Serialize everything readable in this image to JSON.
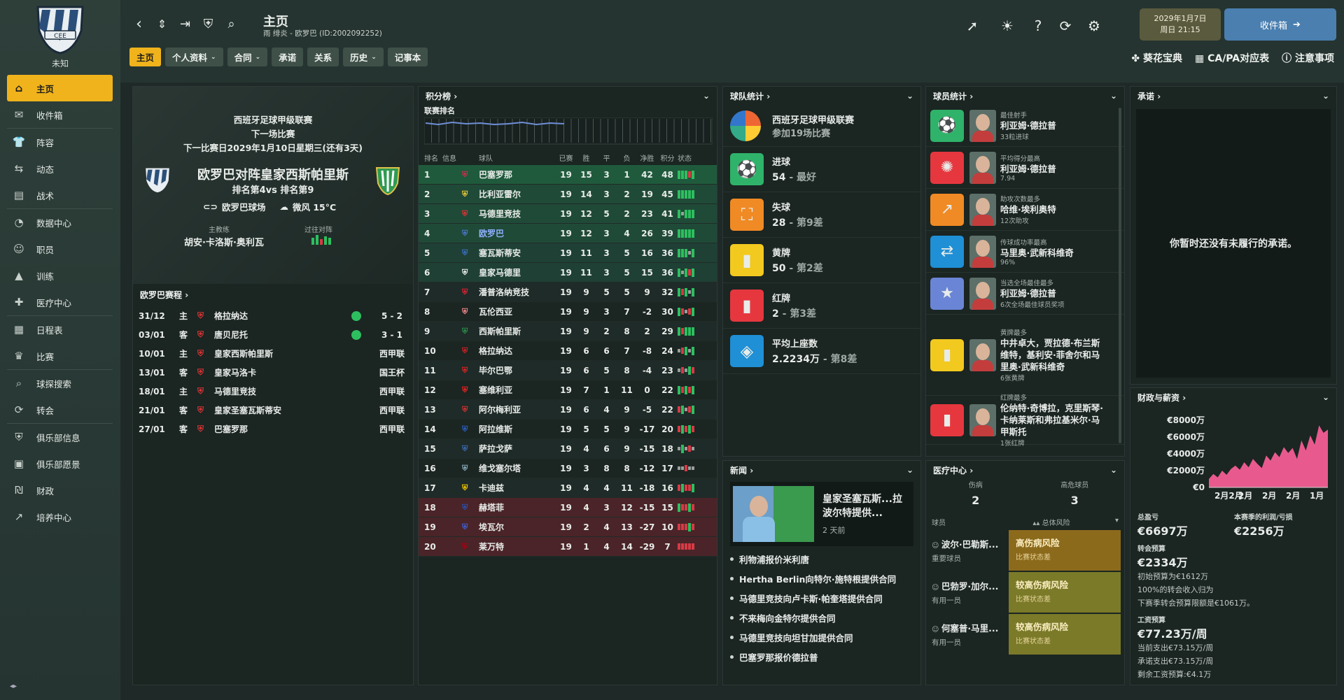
{
  "sidebar": {
    "club_name": "未知",
    "items": [
      {
        "label": "主页",
        "icon": "home-icon"
      },
      {
        "label": "收件箱",
        "icon": "inbox-icon"
      },
      {
        "label": "阵容",
        "icon": "shirt-icon"
      },
      {
        "label": "动态",
        "icon": "dynamics-icon"
      },
      {
        "label": "战术",
        "icon": "tactics-icon"
      },
      {
        "label": "数据中心",
        "icon": "data-icon"
      },
      {
        "label": "职员",
        "icon": "staff-icon"
      },
      {
        "label": "训练",
        "icon": "training-icon"
      },
      {
        "label": "医疗中心",
        "icon": "medical-icon"
      },
      {
        "label": "日程表",
        "icon": "calendar-icon"
      },
      {
        "label": "比赛",
        "icon": "trophy-icon"
      },
      {
        "label": "球探搜索",
        "icon": "search-icon"
      },
      {
        "label": "转会",
        "icon": "transfer-icon"
      },
      {
        "label": "俱乐部信息",
        "icon": "shield-icon"
      },
      {
        "label": "俱乐部愿景",
        "icon": "briefcase-icon"
      },
      {
        "label": "财政",
        "icon": "money-icon"
      },
      {
        "label": "培养中心",
        "icon": "chart-icon"
      }
    ]
  },
  "header": {
    "title": "主页",
    "subtitle": "雨 绯炎 - 欧罗巴 (ID:2002092252)",
    "tabs": [
      "主页",
      "个人资料",
      "合同",
      "承诺",
      "关系",
      "历史",
      "记事本"
    ],
    "date_line1": "2029年1月7日",
    "date_line2": "周日 21:15",
    "inbox_label": "收件箱",
    "links": [
      "葵花宝典",
      "CA/PA对应表",
      "注意事项"
    ]
  },
  "next_match": {
    "competition": "西班牙足球甲级联赛",
    "label": "下一场比赛",
    "date_line": "下一比赛日2029年1月10日星期三(还有3天)",
    "title": "欧罗巴对阵皇家西斯帕里斯",
    "rank_line": "排名第4vs 排名第9",
    "stadium": "欧罗巴球场",
    "weather": "微风 15°C",
    "coach_label": "主教练",
    "coach": "胡安·卡洛斯·奥利瓦",
    "past_label": "过往对阵"
  },
  "fixtures": {
    "title": "欧罗巴赛程",
    "rows": [
      {
        "date": "31/12",
        "venue": "主",
        "team": "格拉纳达",
        "res": "5 - 2",
        "win": true
      },
      {
        "date": "03/01",
        "venue": "客",
        "team": "唐贝尼托",
        "res": "3 - 1",
        "win": true
      },
      {
        "date": "10/01",
        "venue": "主",
        "team": "皇家西斯帕里斯",
        "res": "西甲联",
        "win": false
      },
      {
        "date": "13/01",
        "venue": "客",
        "team": "皇家马洛卡",
        "res": "国王杯",
        "win": false
      },
      {
        "date": "18/01",
        "venue": "主",
        "team": "马德里竞技",
        "res": "西甲联",
        "win": false
      },
      {
        "date": "21/01",
        "venue": "客",
        "team": "皇家圣塞瓦斯蒂安",
        "res": "西甲联",
        "win": false
      },
      {
        "date": "27/01",
        "venue": "客",
        "team": "巴塞罗那",
        "res": "西甲联",
        "win": false
      }
    ]
  },
  "standings": {
    "title": "积分榜",
    "chart_label": "联赛排名",
    "headers": [
      "排名",
      "信息",
      "球队",
      "已赛",
      "胜",
      "平",
      "负",
      "净胜",
      "积分",
      "状态"
    ],
    "rows": [
      {
        "pos": "1",
        "team": "巴塞罗那",
        "p": "19",
        "w": "15",
        "d": "3",
        "l": "1",
        "gd": "42",
        "pts": "48",
        "form": "gggrg",
        "bg": "#1f5a3c"
      },
      {
        "pos": "2",
        "team": "比利亚雷尔",
        "p": "19",
        "w": "14",
        "d": "3",
        "l": "2",
        "gd": "19",
        "pts": "45",
        "form": "ggggg",
        "bg": "#204a38"
      },
      {
        "pos": "3",
        "team": "马德里竞技",
        "p": "19",
        "w": "12",
        "d": "5",
        "l": "2",
        "gd": "23",
        "pts": "41",
        "form": "gyggg",
        "bg": "#204a38"
      },
      {
        "pos": "4",
        "team": "欧罗巴",
        "p": "19",
        "w": "12",
        "d": "3",
        "l": "4",
        "gd": "26",
        "pts": "39",
        "form": "ggggg",
        "bg": "#204a38",
        "highlight": true
      },
      {
        "pos": "5",
        "team": "塞瓦斯蒂安",
        "p": "19",
        "w": "11",
        "d": "3",
        "l": "5",
        "gd": "16",
        "pts": "36",
        "form": "gggyg",
        "bg": "#1f4035"
      },
      {
        "pos": "6",
        "team": "皇家马德里",
        "p": "19",
        "w": "11",
        "d": "3",
        "l": "5",
        "gd": "15",
        "pts": "36",
        "form": "gygrg",
        "bg": "#1f4035"
      },
      {
        "pos": "7",
        "team": "潘普洛纳竞技",
        "p": "19",
        "w": "9",
        "d": "5",
        "l": "5",
        "gd": "9",
        "pts": "32",
        "form": "grgyg",
        "bg": "#1f2b28"
      },
      {
        "pos": "8",
        "team": "瓦伦西亚",
        "p": "19",
        "w": "9",
        "d": "3",
        "l": "7",
        "gd": "-2",
        "pts": "30",
        "form": "gryrg",
        "bg": "#1b2522"
      },
      {
        "pos": "9",
        "team": "西斯帕里斯",
        "p": "19",
        "w": "9",
        "d": "2",
        "l": "8",
        "gd": "2",
        "pts": "29",
        "form": "grggg",
        "bg": "#1f2b28"
      },
      {
        "pos": "10",
        "team": "格拉纳达",
        "p": "19",
        "w": "6",
        "d": "6",
        "l": "7",
        "gd": "-8",
        "pts": "24",
        "form": "yrgyg",
        "bg": "#1b2522"
      },
      {
        "pos": "11",
        "team": "毕尔巴鄂",
        "p": "19",
        "w": "6",
        "d": "5",
        "l": "8",
        "gd": "-4",
        "pts": "23",
        "form": "yrygr",
        "bg": "#1f2b28"
      },
      {
        "pos": "12",
        "team": "塞维利亚",
        "p": "19",
        "w": "7",
        "d": "1",
        "l": "11",
        "gd": "0",
        "pts": "22",
        "form": "grgrg",
        "bg": "#1b2522"
      },
      {
        "pos": "13",
        "team": "阿尔梅利亚",
        "p": "19",
        "w": "6",
        "d": "4",
        "l": "9",
        "gd": "-5",
        "pts": "22",
        "form": "rgyrg",
        "bg": "#1f2b28"
      },
      {
        "pos": "14",
        "team": "阿拉维斯",
        "p": "19",
        "w": "5",
        "d": "5",
        "l": "9",
        "gd": "-17",
        "pts": "20",
        "form": "rgrgr",
        "bg": "#1b2522"
      },
      {
        "pos": "15",
        "team": "萨拉戈萨",
        "p": "19",
        "w": "4",
        "d": "6",
        "l": "9",
        "gd": "-15",
        "pts": "18",
        "form": "ygyry",
        "bg": "#1f2b28"
      },
      {
        "pos": "16",
        "team": "维戈塞尔塔",
        "p": "19",
        "w": "3",
        "d": "8",
        "l": "8",
        "gd": "-12",
        "pts": "17",
        "form": "yyryy",
        "bg": "#1b2522"
      },
      {
        "pos": "17",
        "team": "卡迪兹",
        "p": "19",
        "w": "4",
        "d": "4",
        "l": "11",
        "gd": "-18",
        "pts": "16",
        "form": "rgrrg",
        "bg": "#1f2b28"
      },
      {
        "pos": "18",
        "team": "赫塔菲",
        "p": "19",
        "w": "4",
        "d": "3",
        "l": "12",
        "gd": "-15",
        "pts": "15",
        "form": "grrgr",
        "bg": "#4a2428"
      },
      {
        "pos": "19",
        "team": "埃瓦尔",
        "p": "19",
        "w": "2",
        "d": "4",
        "l": "13",
        "gd": "-27",
        "pts": "10",
        "form": "rrrgr",
        "bg": "#4a2428"
      },
      {
        "pos": "20",
        "team": "莱万特",
        "p": "19",
        "w": "1",
        "d": "4",
        "l": "14",
        "gd": "-29",
        "pts": "7",
        "form": "rrrrr",
        "bg": "#4a2428"
      }
    ]
  },
  "team_stats": {
    "title": "球队统计",
    "league": "西班牙足球甲级联赛",
    "matches": "参加19场比赛",
    "items": [
      {
        "label": "进球",
        "value": "54",
        "rank": "最好",
        "color": "#2fb36a",
        "icon": "goal-net-icon"
      },
      {
        "label": "失球",
        "value": "28",
        "rank": "第9差",
        "color": "#f08a24",
        "icon": "conceded-icon"
      },
      {
        "label": "黄牌",
        "value": "50",
        "rank": "第2差",
        "color": "#f2c91f",
        "icon": "yellow-card-icon"
      },
      {
        "label": "红牌",
        "value": "2",
        "rank": "第3差",
        "color": "#e6373f",
        "icon": "red-card-icon"
      },
      {
        "label": "平均上座数",
        "value": "2.2234万",
        "rank": "第8差",
        "color": "#1f8fd6",
        "icon": "stadium-icon"
      }
    ]
  },
  "player_stats": {
    "title": "球员统计",
    "items": [
      {
        "cat": "最佳射手",
        "name": "利亚姆·德拉普",
        "sub": "33粒进球",
        "color": "#2fb36a",
        "icon": "striker-icon"
      },
      {
        "cat": "平均得分最高",
        "name": "利亚姆·德拉普",
        "sub": "7.94",
        "color": "#e6373f",
        "icon": "rating-icon"
      },
      {
        "cat": "助攻次数最多",
        "name": "哈维·埃利奥特",
        "sub": "12次助攻",
        "color": "#f08a24",
        "icon": "assist-icon"
      },
      {
        "cat": "传球成功率最高",
        "name": "马里奥·武新科维奇",
        "sub": "96%",
        "color": "#1f8fd6",
        "icon": "pass-icon"
      },
      {
        "cat": "当选全场最佳最多",
        "name": "利亚姆·德拉普",
        "sub": "6次全场最佳球员奖项",
        "color": "#6a85d6",
        "icon": "star-icon"
      },
      {
        "cat": "黄牌最多",
        "name": "中井卓大，贾拉德·布兰斯维特，基利安·菲舍尔和马里奥·武新科维奇",
        "sub": "6张黄牌",
        "color": "#f2c91f",
        "icon": "yellow-card-icon"
      },
      {
        "cat": "红牌最多",
        "name": "伦纳特·奇博拉，克里斯琴·卡纳莱斯和弗拉基米尔·马甲斯托",
        "sub": "1张红牌",
        "color": "#e6373f",
        "icon": "red-card-icon"
      }
    ]
  },
  "promises": {
    "title": "承诺",
    "empty": "你暂时还没有未履行的承诺。"
  },
  "news": {
    "title": "新闻",
    "headline": "皇家圣塞瓦斯...拉波尔特提供...",
    "time": "2 天前",
    "items": [
      "利物浦报价米利唐",
      "Hertha Berlin向特尔·施特根提供合同",
      "马德里竞技向卢卡斯·帕奎塔提供合同",
      "不来梅向金特尔提供合同",
      "马德里竞技向坦甘加提供合同",
      "巴塞罗那报价德拉普"
    ]
  },
  "medical": {
    "title": "医疗中心",
    "injured_label": "伤病",
    "injured": "2",
    "high_risk_label": "高危球员",
    "high_risk": "3",
    "col_player": "球员",
    "col_risk": "总体风险",
    "rows": [
      {
        "name": "波尔·巴勒斯...",
        "role": "重要球员",
        "risk": "高伤病风险",
        "note": "比赛状态差",
        "color": "#8c6a1c"
      },
      {
        "name": "巴勃罗·加尔...",
        "role": "有用一员",
        "risk": "较高伤病风险",
        "note": "比赛状态差",
        "color": "#7a7a28"
      },
      {
        "name": "何塞普·马里...",
        "role": "有用一员",
        "risk": "较高伤病风险",
        "note": "比赛状态差",
        "color": "#7a7a28"
      }
    ]
  },
  "finance": {
    "title": "财政与薪资",
    "chart_data": {
      "type": "area",
      "title": "",
      "yticks": [
        "€8000万",
        "€6000万",
        "€4000万",
        "€2000万",
        "€0"
      ],
      "xticks": [
        "2月2月",
        "2月",
        "2月",
        "2月",
        "1月"
      ],
      "ylim": [
        0,
        8000
      ],
      "color": "#e85a8e",
      "series": [
        {
          "values": [
            1000,
            1600,
            1200,
            2000,
            1500,
            2200,
            2600,
            2100,
            3000,
            2400,
            3400,
            2800,
            2300,
            3800,
            3200,
            4200,
            3600,
            4800,
            4100,
            4700,
            3400,
            5600,
            4400,
            6200,
            5100,
            7400,
            6500,
            6900
          ]
        }
      ]
    },
    "balance_label": "总盈亏",
    "balance": "€6697万",
    "season_label": "本赛季的利润/亏损",
    "season": "€2256万",
    "transfer_label": "转会预算",
    "transfer": "€2334万",
    "transfer_lines": [
      "初始预算为€1612万",
      "100%的转会收入归为",
      "下赛季转会预算限额是€1061万。"
    ],
    "wage_label": "工资预算",
    "wage": "€77.23万/周",
    "wage_lines": [
      "当前支出€73.15万/周",
      "承诺支出€73.15万/周",
      "剩余工资预算:€4.1万"
    ]
  }
}
